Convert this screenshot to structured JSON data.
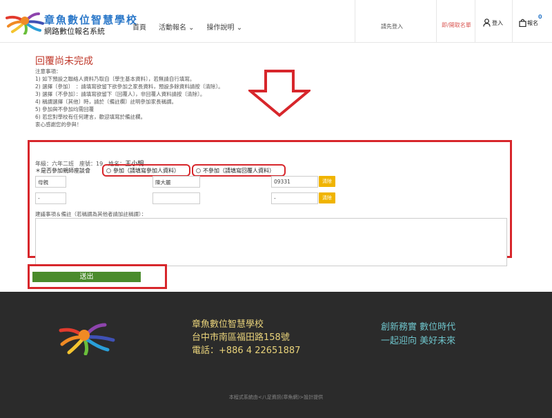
{
  "header": {
    "brand_title": "章魚數位智慧學校",
    "brand_subtitle": "網路數位報名系統",
    "nav": [
      "首頁",
      "活動報名",
      "操作說明"
    ],
    "user_placeholder": "請先登入",
    "query_link": "即/開取名單",
    "login": "登入",
    "signup": "報名",
    "cart_count": "0"
  },
  "notice": {
    "title": "回覆尚未完成",
    "lines": [
      "注意事項：",
      "1) 如下預設之聯絡人資料乃取自〔學生基本資料〕，若無請自行填寫。",
      "2) 選擇〔參加〕　：請填寫欲留下欲參加之家長資料，預設多餘資料請按〔清除〕。",
      "3) 選擇〔不參加〕：請填寫欲留下〔回覆人〕，非回覆人資料請按〔清除〕。",
      "4) 稱謂選擇〔其他〕時，請於〔備註欄〕註明參加家長稱謂。",
      "5) 參加與不參加均需回覆",
      "6) 若您對學校有任何建言，歡迎填寫於備註欄。",
      "衷心感謝您的參與！"
    ]
  },
  "form": {
    "student_info": "年級：六年二班　座號：19　姓名：",
    "student_name": "王小明",
    "question": "＊是否參加親師座談會",
    "option_yes": "參加（請填寫參加人資料）",
    "option_no": "不參加（請填寫回覆人資料）",
    "rows": [
      {
        "relation": "母親",
        "name": "陳大麗",
        "phone": "09331"
      },
      {
        "relation": "-",
        "name": "",
        "phone": "-"
      }
    ],
    "clear_label": "清除",
    "remark_label": "建議事項＆備註（若稱謂為其他者請加註稱謂）：",
    "submit_label": "送出"
  },
  "footer": {
    "school_name": "章魚數位智慧學校",
    "address": "台中市南區福田路158號",
    "phone": "電話：+886 4 22651887",
    "slogan_1": "創新務實 數位時代",
    "slogan_2": "一起迎向 美好未來",
    "copyright": "本程式系統由<八足資訊(章魚網)>設計提供"
  },
  "colors": {
    "brand_blue": "#2b78c9",
    "highlight_red": "#d7262b",
    "submit_green": "#4a8b2c",
    "clear_yellow": "#f0b400",
    "footer_bg": "#2b2b2b",
    "footer_gold": "#e8d27a",
    "footer_teal": "#6ec3ca"
  },
  "icons": {
    "logo": "octopus-logo",
    "login": "user-icon",
    "signup": "shopping-bag-icon",
    "arrow": "down-arrow-icon"
  }
}
